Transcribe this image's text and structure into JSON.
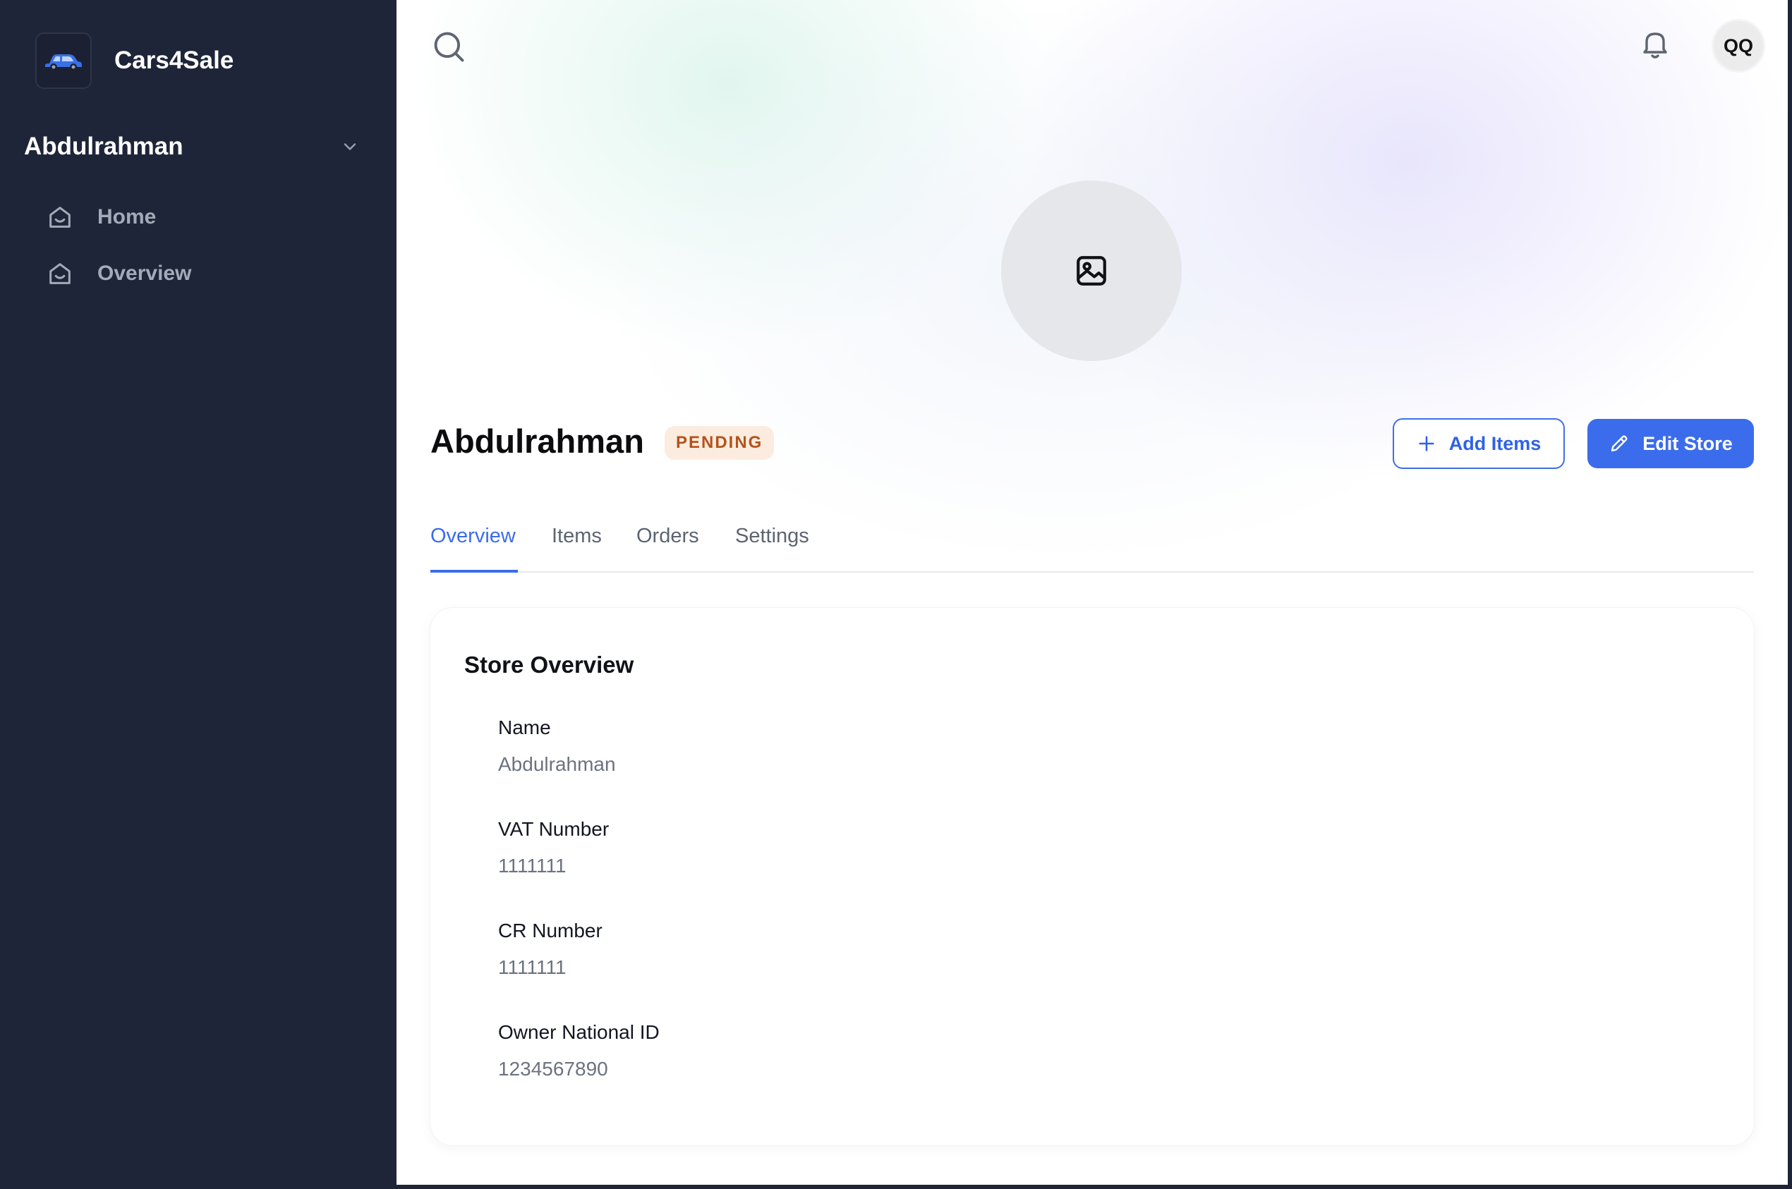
{
  "sidebar": {
    "brand_name": "Cars4Sale",
    "brand_icon": "car-icon",
    "store_switcher": {
      "label": "Abdulrahman",
      "icon": "chevron-down-icon"
    },
    "items": [
      {
        "label": "Home",
        "icon": "store-icon"
      },
      {
        "label": "Overview",
        "icon": "store-icon"
      }
    ]
  },
  "topbar": {
    "search_icon": "search-icon",
    "bell_icon": "bell-icon",
    "avatar_initials": "QQ"
  },
  "store": {
    "image_icon": "image-icon",
    "name": "Abdulrahman",
    "status": "PENDING",
    "status_color": "#b4531c",
    "actions": {
      "add_items": "Add Items",
      "edit_store": "Edit Store"
    },
    "accent_color": "#3b6cec"
  },
  "tabs": [
    {
      "label": "Overview",
      "active": true
    },
    {
      "label": "Items",
      "active": false
    },
    {
      "label": "Orders",
      "active": false
    },
    {
      "label": "Settings",
      "active": false
    }
  ],
  "overview": {
    "title": "Store Overview",
    "fields": [
      {
        "label": "Name",
        "value": "Abdulrahman"
      },
      {
        "label": "VAT Number",
        "value": "1111111"
      },
      {
        "label": "CR Number",
        "value": "1111111"
      },
      {
        "label": "Owner National ID",
        "value": "1234567890"
      }
    ]
  }
}
